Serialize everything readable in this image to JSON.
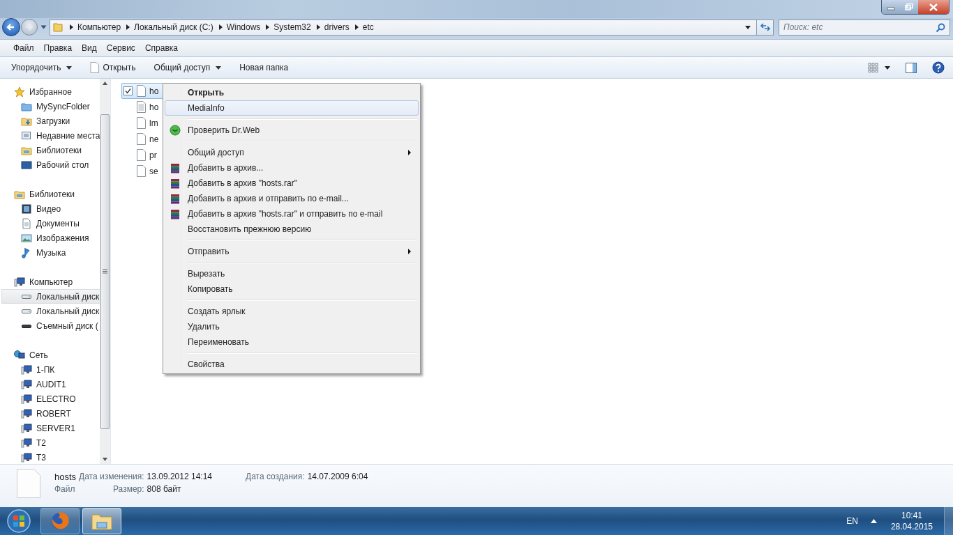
{
  "address_bar": {
    "crumbs": [
      "Компьютер",
      "Локальный диск (C:)",
      "Windows",
      "System32",
      "drivers",
      "etc"
    ]
  },
  "search": {
    "placeholder": "Поиск: etc"
  },
  "menu_bar": [
    "Файл",
    "Правка",
    "Вид",
    "Сервис",
    "Справка"
  ],
  "toolbar": [
    {
      "label": "Упорядочить",
      "kind": "dropdown"
    },
    {
      "label": "Открыть",
      "kind": "file-button"
    },
    {
      "label": "Общий доступ",
      "kind": "dropdown"
    },
    {
      "label": "Новая папка",
      "kind": "button"
    }
  ],
  "nav": [
    {
      "label": "Избранное",
      "kind": "star",
      "items": [
        {
          "label": "MySyncFolder",
          "kind": "sync",
          "selected": false
        },
        {
          "label": "Загрузки",
          "kind": "downloads",
          "selected": false
        },
        {
          "label": "Недавние места",
          "kind": "recent",
          "selected": false
        },
        {
          "label": "Библиотеки",
          "kind": "library",
          "selected": false
        },
        {
          "label": "Рабочий стол",
          "kind": "desktop",
          "selected": false
        }
      ]
    },
    {
      "label": "Библиотеки",
      "kind": "library",
      "items": [
        {
          "label": "Видео",
          "kind": "video",
          "selected": false
        },
        {
          "label": "Документы",
          "kind": "document",
          "selected": false
        },
        {
          "label": "Изображения",
          "kind": "picture",
          "selected": false
        },
        {
          "label": "Музыка",
          "kind": "music",
          "selected": false
        }
      ]
    },
    {
      "label": "Компьютер",
      "kind": "computer",
      "items": [
        {
          "label": "Локальный диск",
          "kind": "drive",
          "selected": true
        },
        {
          "label": "Локальный диск",
          "kind": "drive",
          "selected": false
        },
        {
          "label": "Съемный диск (",
          "kind": "removable",
          "selected": false
        }
      ]
    },
    {
      "label": "Сеть",
      "kind": "network",
      "items": [
        {
          "label": "1-ПК",
          "kind": "computer",
          "selected": false
        },
        {
          "label": "AUDIT1",
          "kind": "computer",
          "selected": false
        },
        {
          "label": "ELECTRO",
          "kind": "computer",
          "selected": false
        },
        {
          "label": "ROBERT",
          "kind": "computer",
          "selected": false
        },
        {
          "label": "SERVER1",
          "kind": "computer",
          "selected": false
        },
        {
          "label": "T2",
          "kind": "computer",
          "selected": false
        },
        {
          "label": "T3",
          "kind": "computer",
          "selected": false
        }
      ]
    }
  ],
  "files": [
    {
      "name": "ho",
      "kind": "file",
      "selected": true
    },
    {
      "name": "ho",
      "kind": "text",
      "selected": false
    },
    {
      "name": "lm",
      "kind": "file",
      "selected": false
    },
    {
      "name": "ne",
      "kind": "file",
      "selected": false
    },
    {
      "name": "pr",
      "kind": "file",
      "selected": false
    },
    {
      "name": "se",
      "kind": "file",
      "selected": false
    }
  ],
  "context_menu": [
    {
      "kind": "item",
      "label": "Открыть",
      "default": true,
      "selected": false,
      "submenu": false
    },
    {
      "kind": "item",
      "label": "MediaInfo",
      "default": false,
      "selected": true,
      "submenu": false
    },
    {
      "kind": "separator"
    },
    {
      "kind": "scan",
      "label": "Проверить Dr.Web",
      "default": false,
      "selected": false,
      "submenu": false
    },
    {
      "kind": "separator"
    },
    {
      "kind": "item",
      "label": "Общий доступ",
      "default": false,
      "selected": false,
      "submenu": true
    },
    {
      "kind": "archive",
      "label": "Добавить в архив...",
      "default": false,
      "selected": false,
      "submenu": false
    },
    {
      "kind": "archive",
      "label": "Добавить в архив \"hosts.rar\"",
      "default": false,
      "selected": false,
      "submenu": false
    },
    {
      "kind": "archive",
      "label": "Добавить в архив и отправить по e-mail...",
      "default": false,
      "selected": false,
      "submenu": false
    },
    {
      "kind": "archive",
      "label": "Добавить в архив \"hosts.rar\" и отправить по e-mail",
      "default": false,
      "selected": false,
      "submenu": false
    },
    {
      "kind": "item",
      "label": "Восстановить прежнюю версию",
      "default": false,
      "selected": false,
      "submenu": false
    },
    {
      "kind": "separator"
    },
    {
      "kind": "item",
      "label": "Отправить",
      "default": false,
      "selected": false,
      "submenu": true
    },
    {
      "kind": "separator"
    },
    {
      "kind": "item",
      "label": "Вырезать",
      "default": false,
      "selected": false,
      "submenu": false
    },
    {
      "kind": "item",
      "label": "Копировать",
      "default": false,
      "selected": false,
      "submenu": false
    },
    {
      "kind": "separator"
    },
    {
      "kind": "item",
      "label": "Создать ярлык",
      "default": false,
      "selected": false,
      "submenu": false
    },
    {
      "kind": "item",
      "label": "Удалить",
      "default": false,
      "selected": false,
      "submenu": false
    },
    {
      "kind": "item",
      "label": "Переименовать",
      "default": false,
      "selected": false,
      "submenu": false
    },
    {
      "kind": "separator"
    },
    {
      "kind": "item",
      "label": "Свойства",
      "default": false,
      "selected": false,
      "submenu": false
    }
  ],
  "details": {
    "name": "hosts",
    "type": "Файл",
    "fields": [
      {
        "label": "Дата изменения:",
        "value": "13.09.2012 14:14"
      },
      {
        "label": "Размер:",
        "value": "808 байт"
      },
      {
        "label": "Дата создания:",
        "value": "14.07.2009 6:04"
      }
    ]
  },
  "taskbar": {
    "apps": [
      {
        "kind": "browser",
        "selected": false
      },
      {
        "kind": "explorer",
        "selected": true
      }
    ],
    "language": "EN",
    "time": "10:41",
    "date": "28.04.2015"
  }
}
